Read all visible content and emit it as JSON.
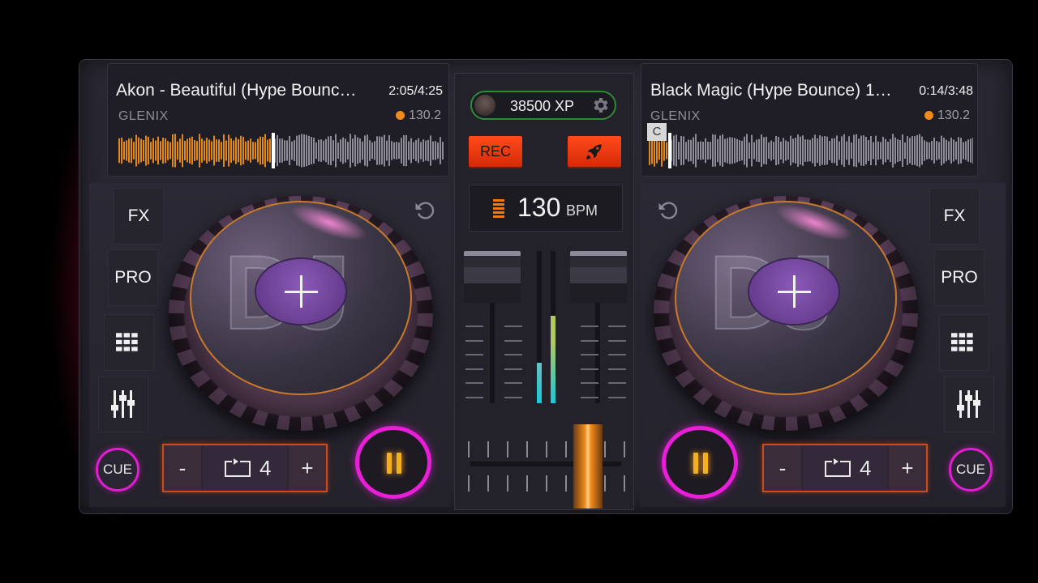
{
  "deck_a": {
    "title": "Akon - Beautiful (Hype Bounc…",
    "time": "2:05/4:25",
    "artist": "GLENIX",
    "bpm": "130.2",
    "progress": 0.47,
    "side_buttons": [
      "FX",
      "PRO"
    ],
    "cue_label": "CUE",
    "loop_minus": "-",
    "loop_value": "4",
    "loop_plus": "+"
  },
  "deck_b": {
    "title": "Black Magic (Hype Bounce) 1…",
    "time": "0:14/3:48",
    "artist": "GLENIX",
    "bpm": "130.2",
    "progress": 0.06,
    "cue_marker": "C",
    "side_buttons": [
      "FX",
      "PRO"
    ],
    "cue_label": "CUE",
    "loop_minus": "-",
    "loop_value": "4",
    "loop_plus": "+"
  },
  "mixer": {
    "xp": "38500 XP",
    "rec_label": "REC",
    "bpm_value": "130",
    "bpm_unit": "BPM",
    "crossfader_position": 0.72
  },
  "colors": {
    "accent_orange": "#f08a1a",
    "accent_magenta": "#e81ed8",
    "rec_red": "#ff4a1a",
    "xp_border": "#2f8a3a"
  },
  "icons": {
    "gear": "gear-icon",
    "rocket": "rocket-icon",
    "grid": "grid-icon",
    "equalizer": "equalizer-icon",
    "reset": "reset-icon",
    "loop": "loop-icon"
  }
}
